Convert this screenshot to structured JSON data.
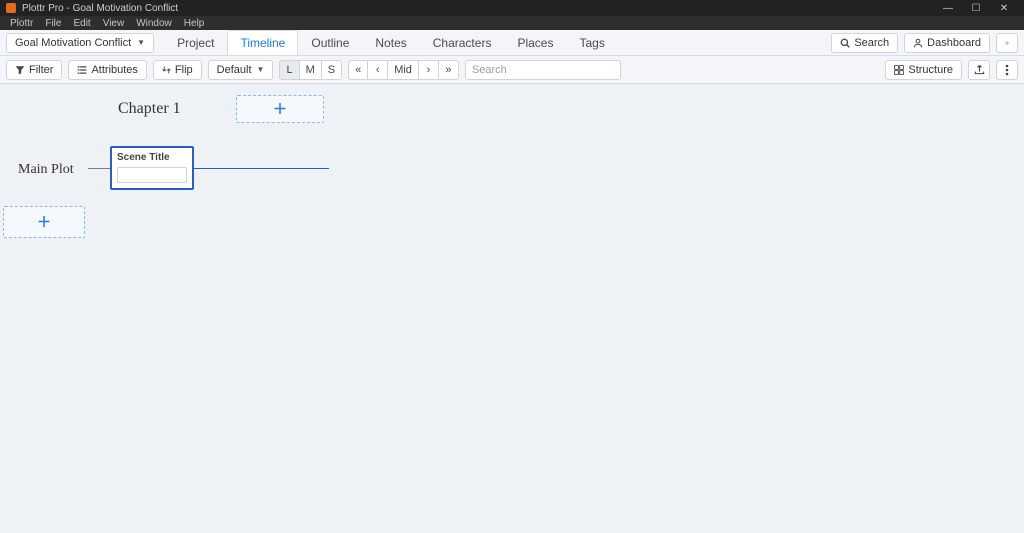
{
  "window": {
    "title": "Plottr Pro - Goal Motivation Conflict"
  },
  "menubar": [
    "Plottr",
    "File",
    "Edit",
    "View",
    "Window",
    "Help"
  ],
  "project_dropdown": "Goal Motivation Conflict",
  "tabs": {
    "project": "Project",
    "timeline": "Timeline",
    "outline": "Outline",
    "notes": "Notes",
    "characters": "Characters",
    "places": "Places",
    "tags": "Tags"
  },
  "top_right": {
    "search": "Search",
    "dashboard": "Dashboard"
  },
  "toolbar": {
    "filter": "Filter",
    "attributes": "Attributes",
    "flip": "Flip",
    "default": "Default",
    "zoom": {
      "L": "L",
      "M": "M",
      "S": "S"
    },
    "nav": {
      "mid": "Mid"
    },
    "search_placeholder": "Search",
    "structure": "Structure"
  },
  "timeline": {
    "chapter_label": "Chapter 1",
    "plotline_label": "Main Plot",
    "scene_card_label": "Scene Title",
    "scene_title_value": ""
  }
}
